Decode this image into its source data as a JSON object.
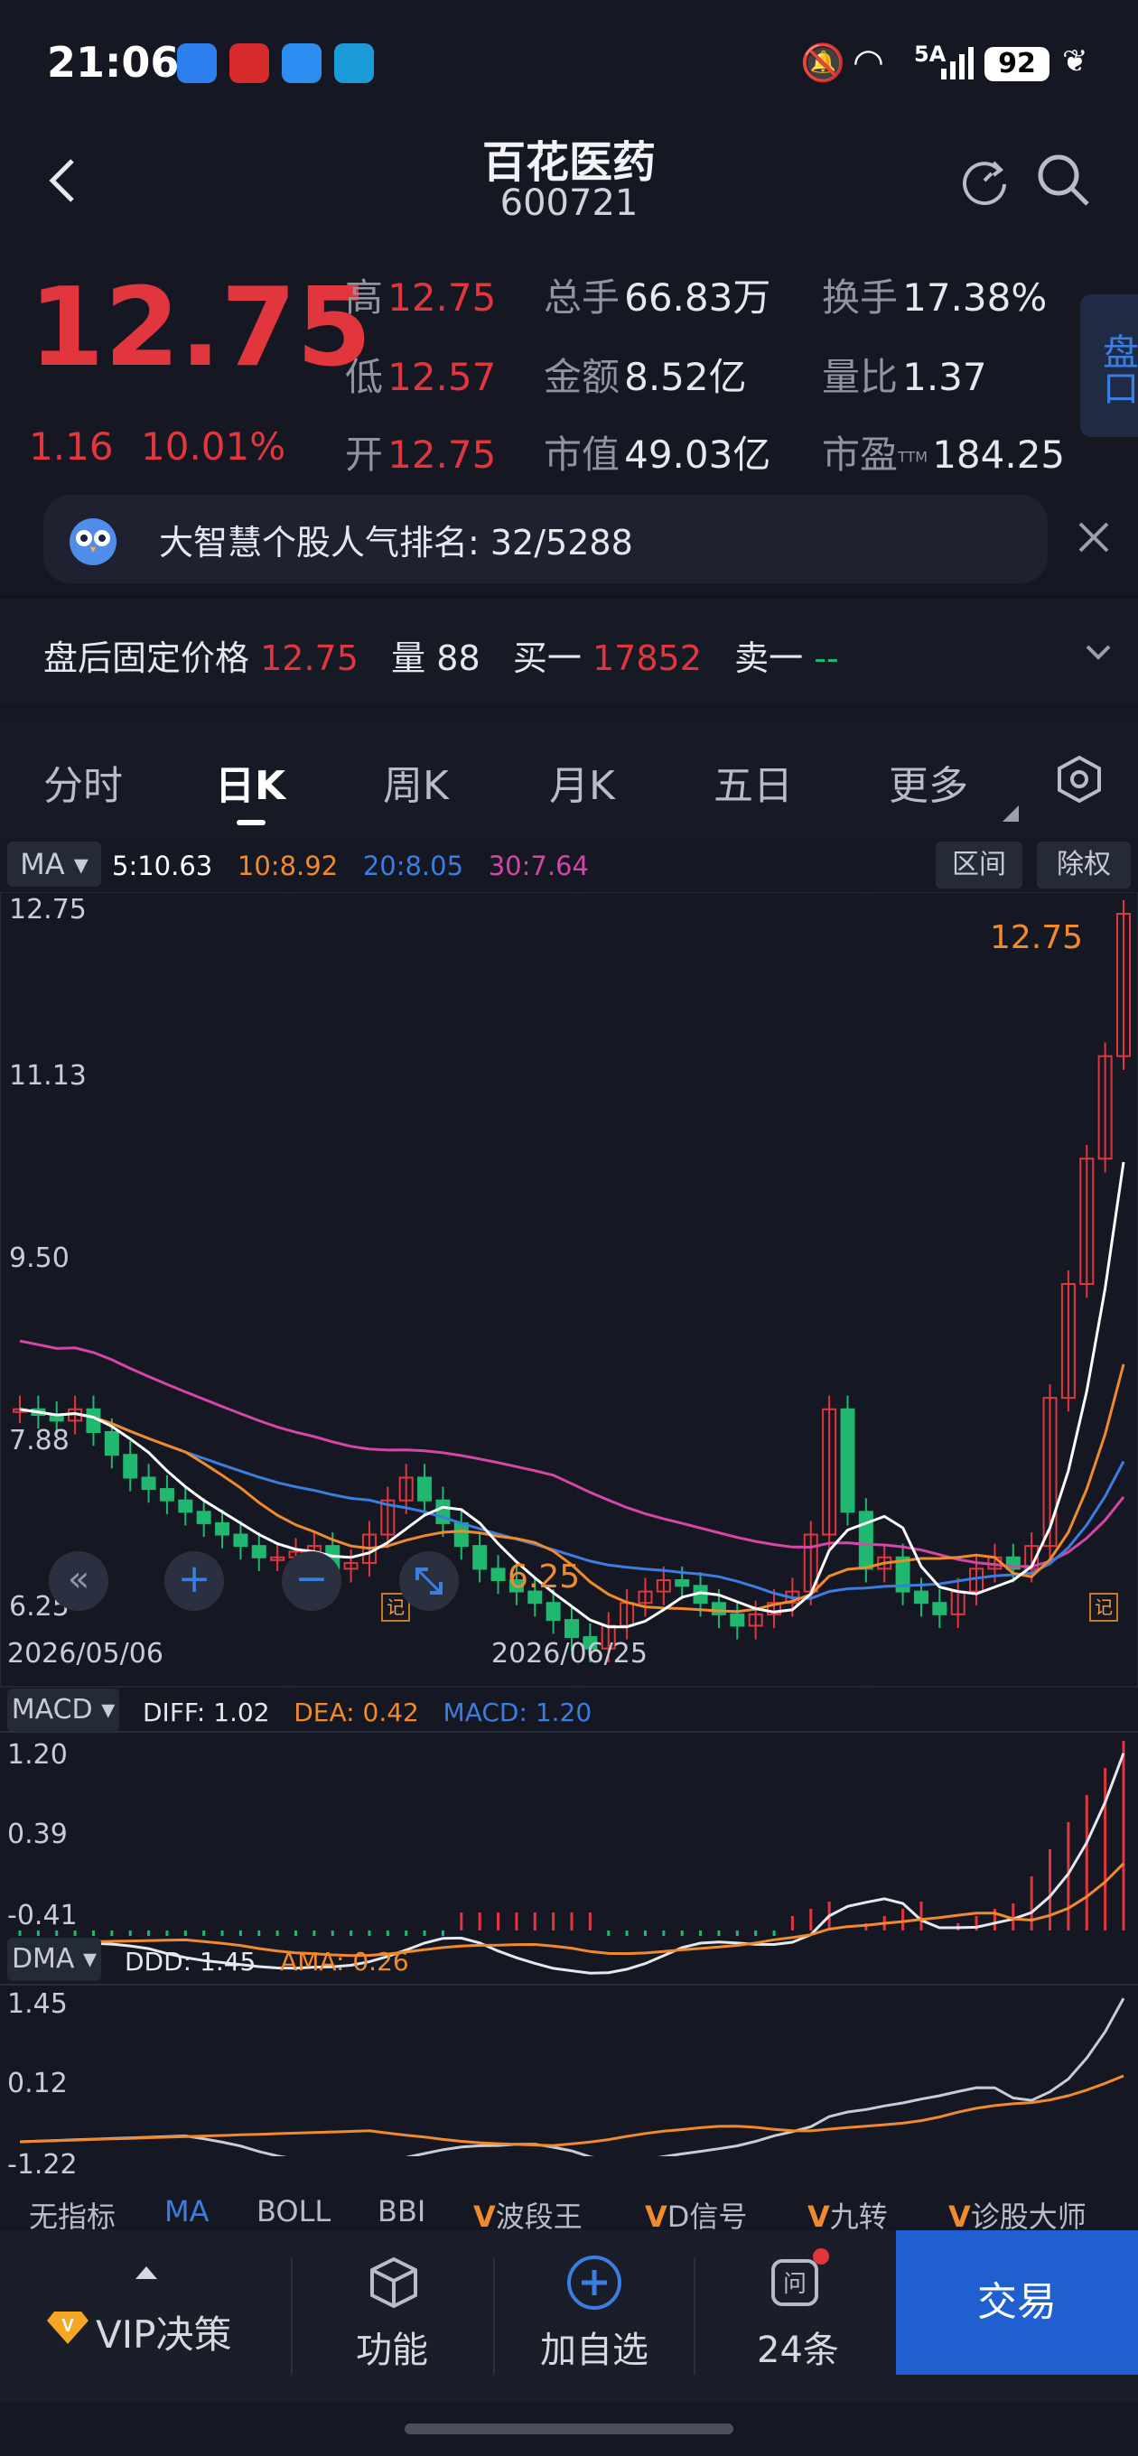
{
  "status_bar": {
    "time": "21:06",
    "network": "5A",
    "battery": "92"
  },
  "header": {
    "stock_name": "百花医药",
    "stock_code": "600721"
  },
  "quote": {
    "price": "12.75",
    "change": "1.16",
    "change_pct": "10.01%",
    "high_label": "高",
    "high": "12.75",
    "low_label": "低",
    "low": "12.57",
    "open_label": "开",
    "open": "12.75",
    "volume_label": "总手",
    "volume": "66.83万",
    "amount_label": "金额",
    "amount": "8.52亿",
    "mktcap_label": "市值",
    "mktcap": "49.03亿",
    "turnover_label": "换手",
    "turnover": "17.38%",
    "vol_ratio_label": "量比",
    "vol_ratio": "1.37",
    "pe_label": "市盈",
    "pe_sup": "TTM",
    "pe": "184.25",
    "side_button": "盘口"
  },
  "banner": {
    "text": "大智慧个股人气排名: 32/5288"
  },
  "after_hours": {
    "label": "盘后固定价格",
    "price": "12.75",
    "vol_label": "量",
    "vol": "88",
    "buy1_label": "买一",
    "buy1": "17852",
    "sell1_label": "卖一",
    "sell1": "--"
  },
  "tabs": [
    "分时",
    "日K",
    "周K",
    "月K",
    "五日",
    "更多"
  ],
  "active_tab": "日K",
  "chart_header": {
    "ma_button": "MA",
    "ma5": "5:10.63",
    "ma10": "10:8.92",
    "ma20": "20:8.05",
    "ma30": "30:7.64",
    "range_button": "区间",
    "adjust_button": "除权"
  },
  "main_chart": {
    "y_labels": [
      "12.75",
      "11.13",
      "9.50",
      "7.88",
      "6.25"
    ],
    "x_labels": [
      "2026/05/06",
      "2026/06/25"
    ],
    "max_annotation": "12.75",
    "min_annotation": "6.25",
    "note_marker": "记"
  },
  "macd": {
    "button": "MACD",
    "diff": "DIFF: 1.02",
    "dea": "DEA: 0.42",
    "macd": "MACD: 1.20",
    "y_labels": [
      "1.20",
      "0.39",
      "-0.41"
    ]
  },
  "dma": {
    "button": "DMA",
    "ddd": "DDD: 1.45",
    "ama": "AMA: 0.26",
    "y_labels": [
      "1.45",
      "0.12",
      "-1.22"
    ]
  },
  "indicators": [
    "无指标",
    "MA",
    "BOLL",
    "BBI",
    "波段王",
    "D信号",
    "九转",
    "诊股大师"
  ],
  "vip_prefix": "V",
  "bottom_bar": {
    "vip": "VIP决策",
    "func": "功能",
    "add": "加自选",
    "qa_count": "24条",
    "trade": "交易"
  },
  "colors": {
    "up": "#e2363e",
    "down": "#1fb86e",
    "ma5": "#ffffff",
    "ma10": "#f08a2c",
    "ma20": "#3b7de0",
    "ma30": "#d646a6",
    "trade_button": "#1f5fd0"
  }
}
